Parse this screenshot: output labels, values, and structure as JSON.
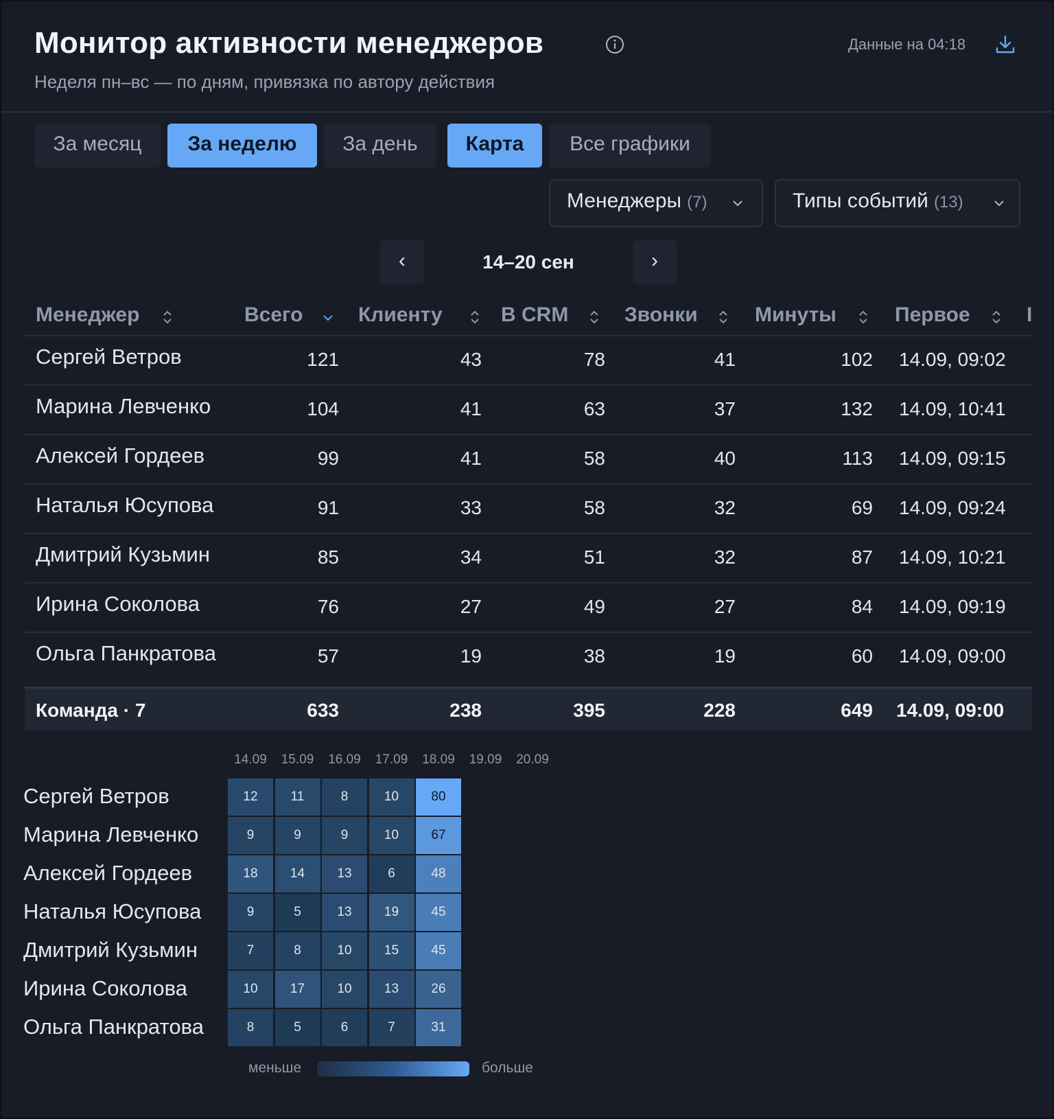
{
  "header": {
    "title": "Монитор активности менеджеров",
    "subtitle": "Неделя пн–вс — по дням, привязка по автору действия",
    "as_of": "Данные на 04:18"
  },
  "tabs": [
    {
      "label": "За месяц",
      "active": false
    },
    {
      "label": "За неделю",
      "active": true
    },
    {
      "label": "За день",
      "active": false
    },
    {
      "label": "Карта",
      "active": true
    },
    {
      "label": "Все графики",
      "active": false
    }
  ],
  "filters": {
    "managers": {
      "label": "Менеджеры",
      "count": "(7)"
    },
    "event_types": {
      "label": "Типы событий",
      "count": "(13)"
    }
  },
  "week_nav": {
    "prev": "‹",
    "next": "›",
    "label": "14–20 сен"
  },
  "table": {
    "headers": [
      "Менеджер",
      "Всего",
      "Клиенту",
      "В CRM",
      "Звонки",
      "Минуты",
      "Первое",
      "I"
    ],
    "rows": [
      [
        "Сергей Ветров",
        "121",
        "43",
        "78",
        "41",
        "102",
        "14.09, 09:02"
      ],
      [
        "Марина Левченко",
        "104",
        "41",
        "63",
        "37",
        "132",
        "14.09, 10:41"
      ],
      [
        "Алексей Гордеев",
        "99",
        "41",
        "58",
        "40",
        "113",
        "14.09, 09:15"
      ],
      [
        "Наталья Юсупова",
        "91",
        "33",
        "58",
        "32",
        "69",
        "14.09, 09:24"
      ],
      [
        "Дмитрий Кузьмин",
        "85",
        "34",
        "51",
        "32",
        "87",
        "14.09, 10:21"
      ],
      [
        "Ирина Соколова",
        "76",
        "27",
        "49",
        "27",
        "84",
        "14.09, 09:19"
      ],
      [
        "Ольга Панкратова",
        "57",
        "19",
        "38",
        "19",
        "60",
        "14.09, 09:00"
      ]
    ],
    "total": [
      "Команда · 7",
      "633",
      "238",
      "395",
      "228",
      "649",
      "14.09, 09:00"
    ]
  },
  "heatmap": {
    "dates": [
      "14.09",
      "15.09",
      "16.09",
      "17.09",
      "18.09",
      "19.09",
      "20.09"
    ],
    "managers": [
      "Сергей Ветров",
      "Марина Левченко",
      "Алексей Гордеев",
      "Наталья Юсупова",
      "Дмитрий Кузьмин",
      "Ирина Соколова",
      "Ольга Панкратова"
    ],
    "values": [
      [
        12,
        11,
        8,
        10,
        80
      ],
      [
        9,
        9,
        9,
        10,
        67
      ],
      [
        18,
        14,
        13,
        6,
        48
      ],
      [
        9,
        5,
        13,
        19,
        45
      ],
      [
        7,
        8,
        10,
        15,
        45
      ],
      [
        10,
        17,
        10,
        13,
        26
      ],
      [
        8,
        5,
        6,
        7,
        31
      ]
    ],
    "legend_low": "меньше",
    "legend_high": "больше",
    "colors": {
      "low": "#1f2f44",
      "high": "#66a8f5"
    }
  }
}
